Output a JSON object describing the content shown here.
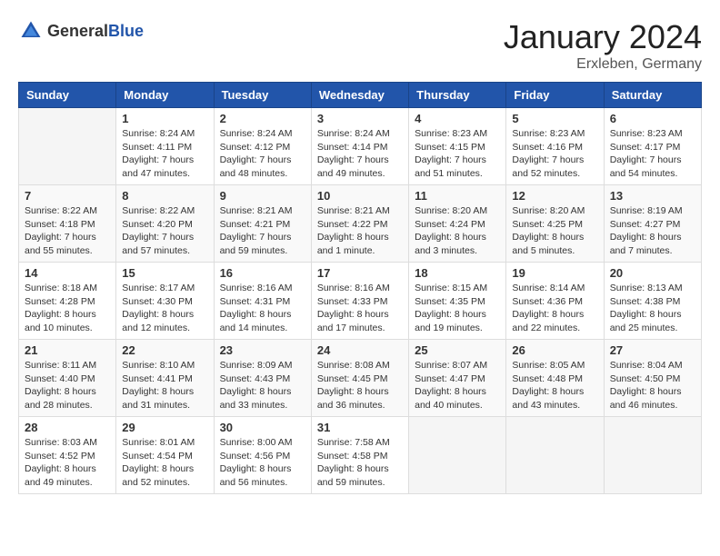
{
  "header": {
    "logo_general": "General",
    "logo_blue": "Blue",
    "month_year": "January 2024",
    "location": "Erxleben, Germany"
  },
  "days_of_week": [
    "Sunday",
    "Monday",
    "Tuesday",
    "Wednesday",
    "Thursday",
    "Friday",
    "Saturday"
  ],
  "weeks": [
    [
      {
        "day": "",
        "info": ""
      },
      {
        "day": "1",
        "info": "Sunrise: 8:24 AM\nSunset: 4:11 PM\nDaylight: 7 hours\nand 47 minutes."
      },
      {
        "day": "2",
        "info": "Sunrise: 8:24 AM\nSunset: 4:12 PM\nDaylight: 7 hours\nand 48 minutes."
      },
      {
        "day": "3",
        "info": "Sunrise: 8:24 AM\nSunset: 4:14 PM\nDaylight: 7 hours\nand 49 minutes."
      },
      {
        "day": "4",
        "info": "Sunrise: 8:23 AM\nSunset: 4:15 PM\nDaylight: 7 hours\nand 51 minutes."
      },
      {
        "day": "5",
        "info": "Sunrise: 8:23 AM\nSunset: 4:16 PM\nDaylight: 7 hours\nand 52 minutes."
      },
      {
        "day": "6",
        "info": "Sunrise: 8:23 AM\nSunset: 4:17 PM\nDaylight: 7 hours\nand 54 minutes."
      }
    ],
    [
      {
        "day": "7",
        "info": "Sunrise: 8:22 AM\nSunset: 4:18 PM\nDaylight: 7 hours\nand 55 minutes."
      },
      {
        "day": "8",
        "info": "Sunrise: 8:22 AM\nSunset: 4:20 PM\nDaylight: 7 hours\nand 57 minutes."
      },
      {
        "day": "9",
        "info": "Sunrise: 8:21 AM\nSunset: 4:21 PM\nDaylight: 7 hours\nand 59 minutes."
      },
      {
        "day": "10",
        "info": "Sunrise: 8:21 AM\nSunset: 4:22 PM\nDaylight: 8 hours\nand 1 minute."
      },
      {
        "day": "11",
        "info": "Sunrise: 8:20 AM\nSunset: 4:24 PM\nDaylight: 8 hours\nand 3 minutes."
      },
      {
        "day": "12",
        "info": "Sunrise: 8:20 AM\nSunset: 4:25 PM\nDaylight: 8 hours\nand 5 minutes."
      },
      {
        "day": "13",
        "info": "Sunrise: 8:19 AM\nSunset: 4:27 PM\nDaylight: 8 hours\nand 7 minutes."
      }
    ],
    [
      {
        "day": "14",
        "info": "Sunrise: 8:18 AM\nSunset: 4:28 PM\nDaylight: 8 hours\nand 10 minutes."
      },
      {
        "day": "15",
        "info": "Sunrise: 8:17 AM\nSunset: 4:30 PM\nDaylight: 8 hours\nand 12 minutes."
      },
      {
        "day": "16",
        "info": "Sunrise: 8:16 AM\nSunset: 4:31 PM\nDaylight: 8 hours\nand 14 minutes."
      },
      {
        "day": "17",
        "info": "Sunrise: 8:16 AM\nSunset: 4:33 PM\nDaylight: 8 hours\nand 17 minutes."
      },
      {
        "day": "18",
        "info": "Sunrise: 8:15 AM\nSunset: 4:35 PM\nDaylight: 8 hours\nand 19 minutes."
      },
      {
        "day": "19",
        "info": "Sunrise: 8:14 AM\nSunset: 4:36 PM\nDaylight: 8 hours\nand 22 minutes."
      },
      {
        "day": "20",
        "info": "Sunrise: 8:13 AM\nSunset: 4:38 PM\nDaylight: 8 hours\nand 25 minutes."
      }
    ],
    [
      {
        "day": "21",
        "info": "Sunrise: 8:11 AM\nSunset: 4:40 PM\nDaylight: 8 hours\nand 28 minutes."
      },
      {
        "day": "22",
        "info": "Sunrise: 8:10 AM\nSunset: 4:41 PM\nDaylight: 8 hours\nand 31 minutes."
      },
      {
        "day": "23",
        "info": "Sunrise: 8:09 AM\nSunset: 4:43 PM\nDaylight: 8 hours\nand 33 minutes."
      },
      {
        "day": "24",
        "info": "Sunrise: 8:08 AM\nSunset: 4:45 PM\nDaylight: 8 hours\nand 36 minutes."
      },
      {
        "day": "25",
        "info": "Sunrise: 8:07 AM\nSunset: 4:47 PM\nDaylight: 8 hours\nand 40 minutes."
      },
      {
        "day": "26",
        "info": "Sunrise: 8:05 AM\nSunset: 4:48 PM\nDaylight: 8 hours\nand 43 minutes."
      },
      {
        "day": "27",
        "info": "Sunrise: 8:04 AM\nSunset: 4:50 PM\nDaylight: 8 hours\nand 46 minutes."
      }
    ],
    [
      {
        "day": "28",
        "info": "Sunrise: 8:03 AM\nSunset: 4:52 PM\nDaylight: 8 hours\nand 49 minutes."
      },
      {
        "day": "29",
        "info": "Sunrise: 8:01 AM\nSunset: 4:54 PM\nDaylight: 8 hours\nand 52 minutes."
      },
      {
        "day": "30",
        "info": "Sunrise: 8:00 AM\nSunset: 4:56 PM\nDaylight: 8 hours\nand 56 minutes."
      },
      {
        "day": "31",
        "info": "Sunrise: 7:58 AM\nSunset: 4:58 PM\nDaylight: 8 hours\nand 59 minutes."
      },
      {
        "day": "",
        "info": ""
      },
      {
        "day": "",
        "info": ""
      },
      {
        "day": "",
        "info": ""
      }
    ]
  ]
}
